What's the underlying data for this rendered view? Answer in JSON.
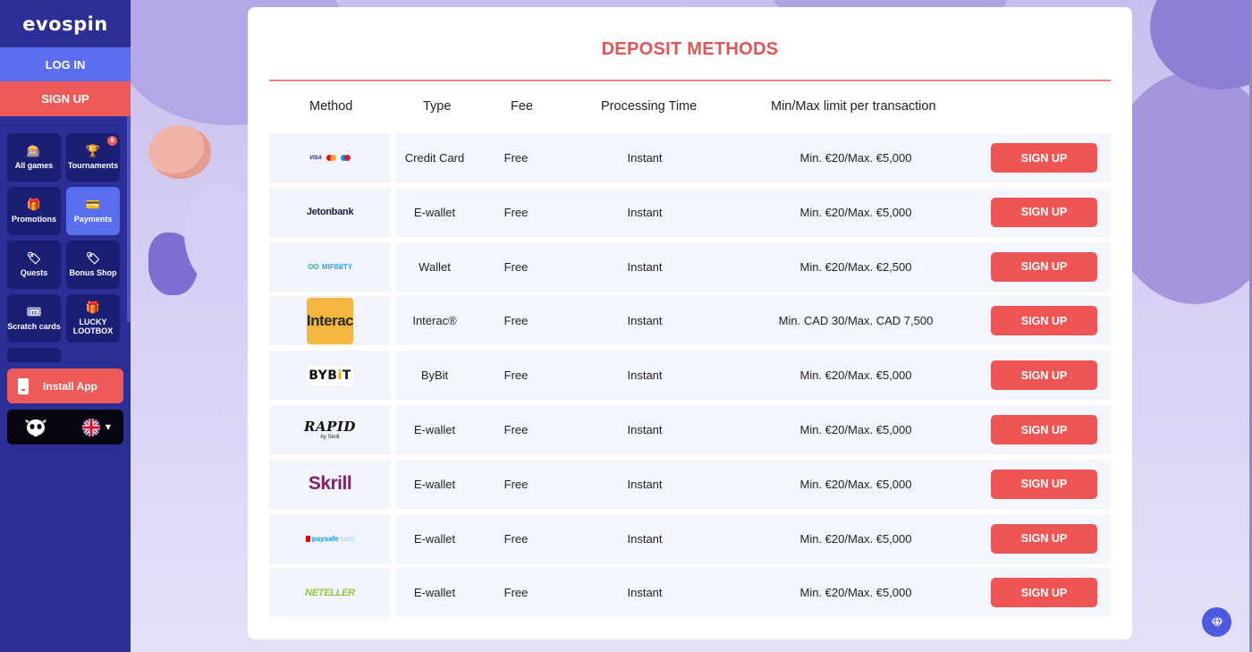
{
  "brand": {
    "logo_text": "evospin"
  },
  "auth": {
    "login_label": "LOG IN",
    "signup_label": "SIGN UP"
  },
  "menu": {
    "items": [
      {
        "id": "all-games",
        "label": "All games",
        "icon": "slot-machine-icon",
        "glyph": "🎰",
        "active": false,
        "badge": ""
      },
      {
        "id": "tournaments",
        "label": "Tournaments",
        "icon": "trophy-icon",
        "glyph": "🏆",
        "active": false,
        "badge": "9"
      },
      {
        "id": "promotions",
        "label": "Promotions",
        "icon": "gift-icon",
        "glyph": "🎁",
        "active": false,
        "badge": ""
      },
      {
        "id": "payments",
        "label": "Payments",
        "icon": "wallet-icon",
        "glyph": "💳",
        "active": true,
        "badge": ""
      },
      {
        "id": "quests",
        "label": "Quests",
        "icon": "tag-icon",
        "glyph": "🏷",
        "active": false,
        "badge": ""
      },
      {
        "id": "bonus-shop",
        "label": "Bonus Shop",
        "icon": "price-tag-icon",
        "glyph": "🏷",
        "active": false,
        "badge": ""
      },
      {
        "id": "scratch-cards",
        "label": "Scratch cards",
        "icon": "ticket-icon",
        "glyph": "🎟",
        "active": false,
        "badge": ""
      },
      {
        "id": "lucky-lootbox",
        "label": "LUCKY LOOTBOX",
        "icon": "lootbox-icon",
        "glyph": "🎁",
        "active": false,
        "badge": ""
      }
    ]
  },
  "install_app": {
    "label": "Install App",
    "icon": "phone-icon"
  },
  "language": {
    "selected": "en",
    "flag_icon": "uk-flag-icon"
  },
  "deposit": {
    "title": "DEPOSIT METHODS",
    "headers": {
      "method": "Method",
      "type": "Type",
      "fee": "Fee",
      "processing": "Processing Time",
      "limits": "Min/Max limit per transaction"
    },
    "rows": [
      {
        "method": "Visa / Mastercard / Maestro",
        "logo": "cards",
        "type": "Credit Card",
        "fee": "Free",
        "processing": "Instant",
        "limits": "Min. €20/Max. €5,000",
        "button": "SIGN UP"
      },
      {
        "method": "Jetonbank",
        "logo": "jeton",
        "type": "E-wallet",
        "fee": "Free",
        "processing": "Instant",
        "limits": "Min. €20/Max. €5,000",
        "button": "SIGN UP"
      },
      {
        "method": "MiFinity",
        "logo": "mifinity",
        "type": "Wallet",
        "fee": "Free",
        "processing": "Instant",
        "limits": "Min. €20/Max. €2,500",
        "button": "SIGN UP"
      },
      {
        "method": "Interac",
        "logo": "interac",
        "type": "Interac®",
        "fee": "Free",
        "processing": "Instant",
        "limits": "Min. CAD 30/Max. CAD 7,500",
        "button": "SIGN UP"
      },
      {
        "method": "Bybit",
        "logo": "bybit",
        "type": "ByBit",
        "fee": "Free",
        "processing": "Instant",
        "limits": "Min. €20/Max. €5,000",
        "button": "SIGN UP"
      },
      {
        "method": "Rapid by Skrill",
        "logo": "rapid",
        "type": "E-wallet",
        "fee": "Free",
        "processing": "Instant",
        "limits": "Min. €20/Max. €5,000",
        "button": "SIGN UP"
      },
      {
        "method": "Skrill",
        "logo": "skrill",
        "type": "E-wallet",
        "fee": "Free",
        "processing": "Instant",
        "limits": "Min. €20/Max. €5,000",
        "button": "SIGN UP"
      },
      {
        "method": "paysafecard",
        "logo": "paysafecard",
        "type": "E-wallet",
        "fee": "Free",
        "processing": "Instant",
        "limits": "Min. €20/Max. €5,000",
        "button": "SIGN UP"
      },
      {
        "method": "Neteller",
        "logo": "neteller",
        "type": "E-wallet",
        "fee": "Free",
        "processing": "Instant",
        "limits": "Min. €20/Max. €5,000",
        "button": "SIGN UP"
      }
    ],
    "logo_text": {
      "visa": "VISA",
      "jeton": "Jetonbank",
      "mifinity": "MIFINITY",
      "interac": "Interac",
      "bybit_a": "BYB",
      "bybit_b": "i",
      "bybit_c": "T",
      "rapid_a": "RAPID",
      "rapid_b": "by Skrill",
      "skrill": "Skrill",
      "psc_a": "paysafe",
      "psc_b": "card",
      "neteller": "NETELLER"
    }
  },
  "colors": {
    "sidebar": "#2b2f95",
    "accent_blue": "#5a6ef0",
    "accent_red": "#ee5a5a",
    "title_red": "#e05656"
  },
  "chat": {
    "icon": "chat-support-icon"
  }
}
